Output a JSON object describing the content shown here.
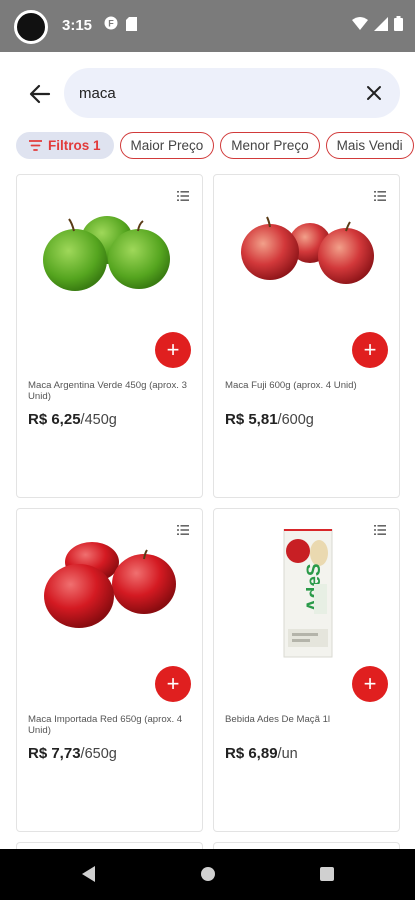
{
  "status_bar": {
    "time": "3:15"
  },
  "search": {
    "value": "maca"
  },
  "chips": {
    "filter_label": "Filtros 1",
    "options": [
      "Maior Preço",
      "Menor Preço",
      "Mais Vendi"
    ]
  },
  "products": [
    {
      "name": "Maca Argentina Verde 450g (aprox. 3 Unid)",
      "price": "R$ 6,25",
      "unit": "/450g",
      "image": "green-apples"
    },
    {
      "name": "Maca Fuji 600g (aprox. 4 Unid)",
      "price": "R$ 5,81",
      "unit": "/600g",
      "image": "fuji-apples"
    },
    {
      "name": "Maca Importada Red 650g (aprox. 4 Unid)",
      "price": "R$ 7,73",
      "unit": "/650g",
      "image": "red-apples"
    },
    {
      "name": "Bebida Ades De Maçã 1l",
      "price": "R$ 6,89",
      "unit": "/un",
      "image": "ades-carton"
    }
  ],
  "colors": {
    "accent": "#e01f1f",
    "search_bg": "#edf0fa",
    "filter_chip_bg": "#dfe3f0"
  }
}
